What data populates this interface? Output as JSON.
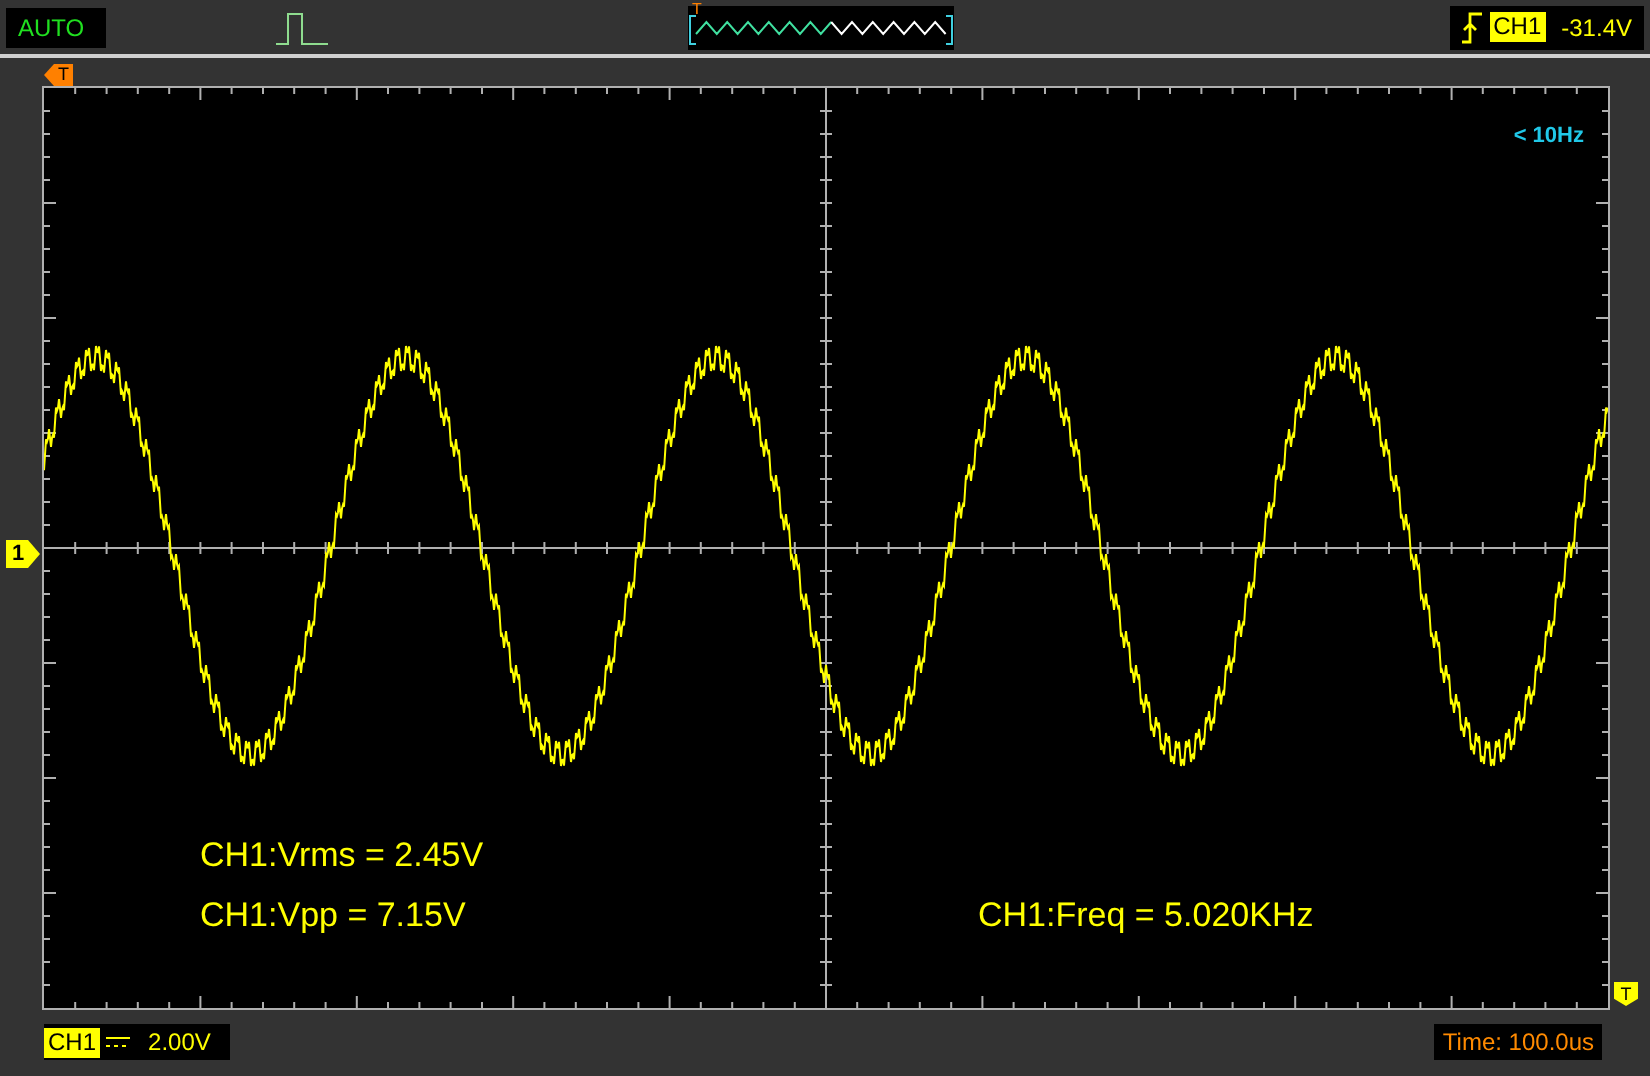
{
  "status": {
    "mode": "AUTO"
  },
  "overview": {
    "trigger_marker": "T"
  },
  "trigger": {
    "channel": "CH1",
    "level": "-31.4V"
  },
  "markers": {
    "time_marker": "T",
    "channel_marker": "1",
    "level_marker": "T"
  },
  "screen": {
    "frequency_note": "< 10Hz",
    "measurements": [
      {
        "text": "CH1:Vrms = 2.45V"
      },
      {
        "text": "CH1:Vpp = 7.15V"
      },
      {
        "text": "CH1:Freq = 5.020KHz"
      }
    ]
  },
  "bottom": {
    "channel": "CH1",
    "scale": "2.00V",
    "timebase": "Time: 100.0us"
  }
}
